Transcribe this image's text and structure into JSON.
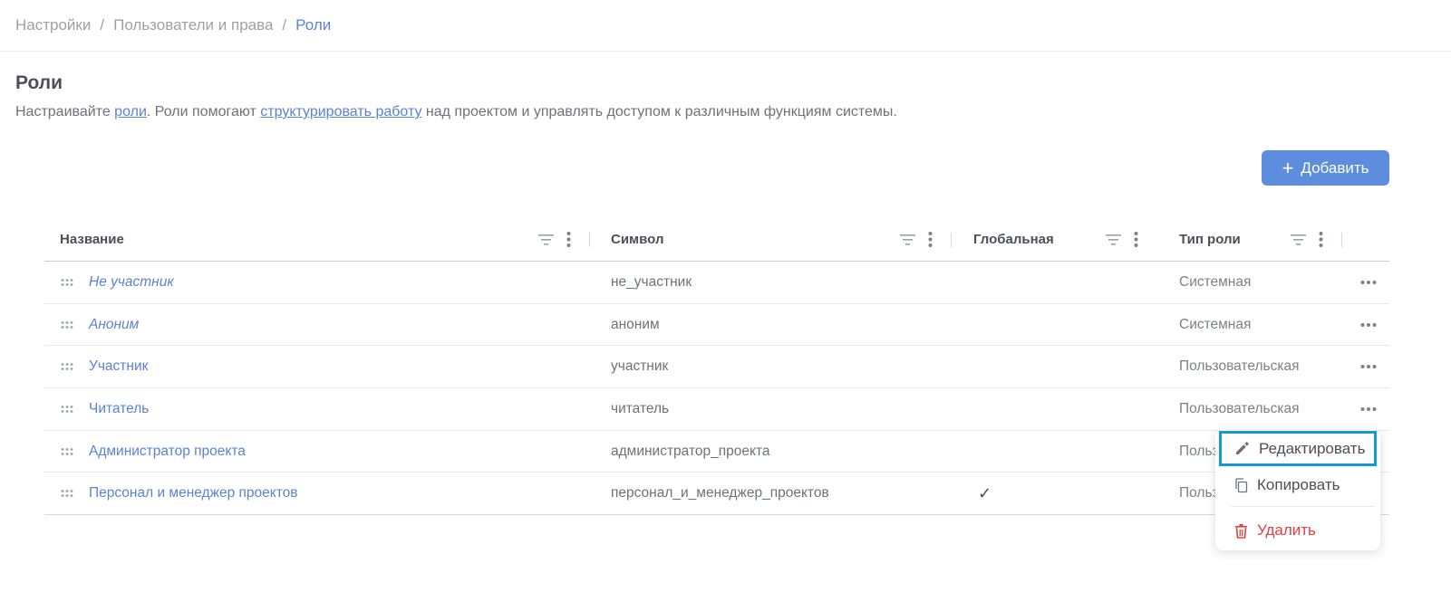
{
  "breadcrumb": {
    "items": [
      "Настройки",
      "Пользователи и права"
    ],
    "current": "Роли",
    "separator": "/"
  },
  "page": {
    "title": "Роли",
    "desc_part1": "Настраивайте ",
    "desc_link1": "роли",
    "desc_part2": ". Роли помогают ",
    "desc_link2": "структурировать работу",
    "desc_part3": " над проектом и управлять доступом к различным функциям системы."
  },
  "toolbar": {
    "add_label": "Добавить",
    "add_icon": "plus-icon",
    "accent_color": "#5d8ddd"
  },
  "table": {
    "columns": [
      "Название",
      "Символ",
      "Глобальная",
      "Тип роли"
    ],
    "rows": [
      {
        "name": "Не участник",
        "symbol": "не_участник",
        "global": "",
        "type": "Системная",
        "italic": true
      },
      {
        "name": "Аноним",
        "symbol": "аноним",
        "global": "",
        "type": "Системная",
        "italic": true
      },
      {
        "name": "Участник",
        "symbol": "участник",
        "global": "",
        "type": "Пользовательская",
        "italic": false
      },
      {
        "name": "Читатель",
        "symbol": "читатель",
        "global": "",
        "type": "Пользовательская",
        "italic": false
      },
      {
        "name": "Администратор проекта",
        "symbol": "администратор_проекта",
        "global": "",
        "type": "Польз",
        "italic": false
      },
      {
        "name": "Персонал и менеджер проектов",
        "symbol": "персонал_и_менеджер_проектов",
        "global": "✓",
        "type": "Польз",
        "italic": false
      }
    ]
  },
  "menu": {
    "edit": "Редактировать",
    "copy": "Копировать",
    "delete": "Удалить",
    "delete_color": "#e2403f",
    "highlight_color": "#119bd6"
  }
}
